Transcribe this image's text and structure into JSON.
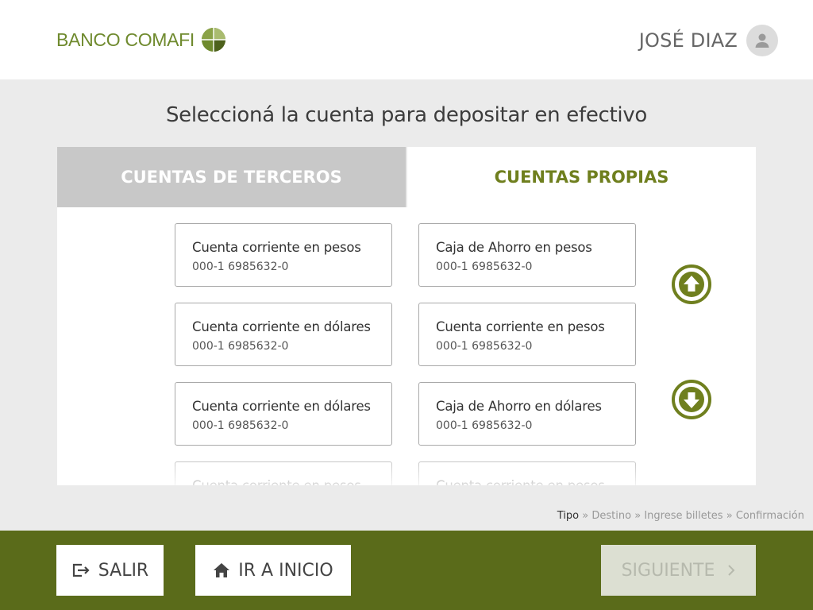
{
  "header": {
    "logo_text": "BANCO COMAFI",
    "user_name": "JOSÉ DIAZ",
    "icons": {
      "logo": "comafi-globe-icon",
      "avatar": "user-icon"
    }
  },
  "page": {
    "title": "Seleccioná la cuenta para depositar en efectivo"
  },
  "tabs": {
    "terceros": "CUENTAS DE TERCEROS",
    "propias": "CUENTAS PROPIAS",
    "active": "propias"
  },
  "accounts": {
    "left": [
      {
        "name": "Cuenta corriente en pesos",
        "number": "000-1 6985632-0"
      },
      {
        "name": "Cuenta corriente en dólares",
        "number": "000-1 6985632-0"
      },
      {
        "name": "Cuenta corriente en dólares",
        "number": "000-1 6985632-0"
      },
      {
        "name": "Cuenta corriente en pesos"
      }
    ],
    "right": [
      {
        "name": "Caja de Ahorro en pesos",
        "number": "000-1 6985632-0"
      },
      {
        "name": "Cuenta corriente en pesos",
        "number": "000-1 6985632-0"
      },
      {
        "name": "Caja de Ahorro en dólares",
        "number": "000-1 6985632-0"
      },
      {
        "name": "Cuenta corriente en pesos"
      }
    ]
  },
  "scroll": {
    "up_icon": "arrow-up-circle-icon",
    "down_icon": "arrow-down-circle-icon"
  },
  "breadcrumb": {
    "steps": [
      "Tipo",
      "Destino",
      "Ingrese billetes",
      "Confirmación"
    ],
    "separator": "»",
    "current": "Tipo"
  },
  "footer": {
    "exit_label": "SALIR",
    "home_label": "IR A INICIO",
    "next_label": "SIGUIENTE"
  },
  "colors": {
    "brand_green": "#6f8a2e",
    "footer_green": "#5a6b1a",
    "tab_active_text": "#6f7f1e",
    "tab_inactive_bg": "#c8c8c8",
    "page_bg": "#ebebeb",
    "disabled_button_bg": "#dcdfd2"
  }
}
